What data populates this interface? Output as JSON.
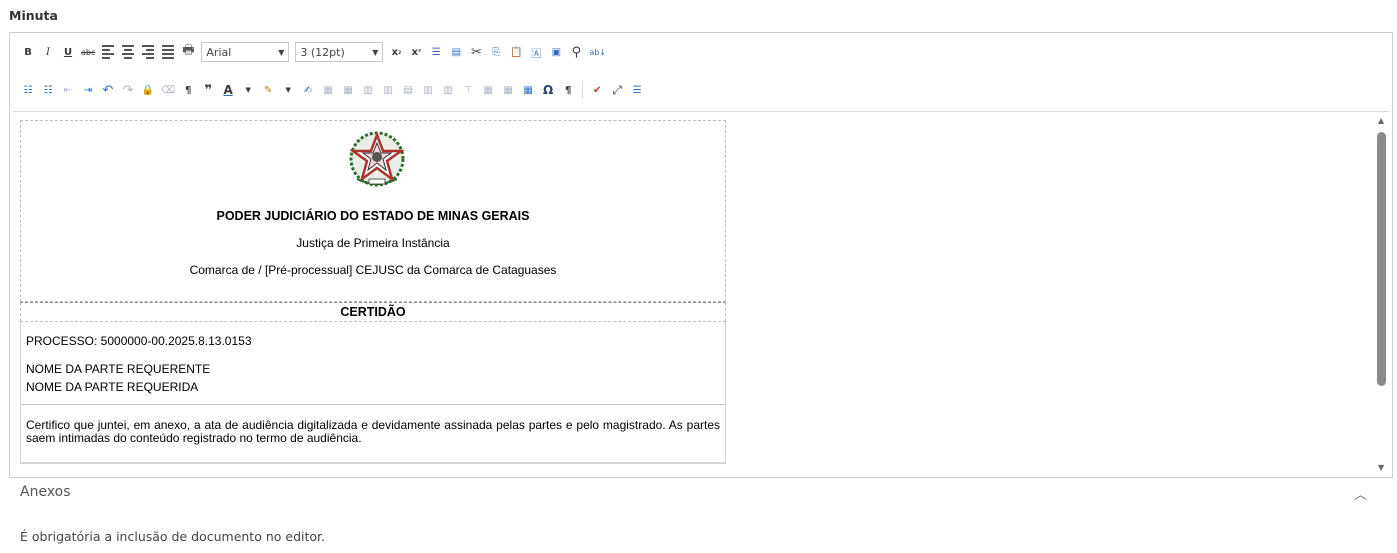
{
  "section_label": "Minuta",
  "toolbar": {
    "font_family": "Arial",
    "font_size": "3 (12pt)"
  },
  "document": {
    "court_title": "PODER JUDICIÁRIO DO ESTADO DE MINAS GERAIS",
    "instance": "Justiça de Primeira Instância",
    "district": "Comarca de  / [Pré-processual] CEJUSC da Comarca de Cataguases",
    "cert_heading": "CERTIDÃO",
    "process": "PROCESSO: 5000000-00.2025.8.13.0153",
    "party_requester": "NOME DA PARTE REQUERENTE",
    "party_requested": "NOME DA PARTE REQUERIDA",
    "body": "Certifico que juntei, em anexo, a ata de audiência digitalizada e devidamente assinada pelas partes e pelo magistrado. As partes saem intimadas do conteúdo registrado no termo de audiência."
  },
  "attachments": {
    "label": "Anexos",
    "notice": "É obrigatória a inclusão de documento no editor."
  },
  "colors": {
    "accent_blue": "#2f6ec4",
    "seal_red": "#b03030",
    "seal_green": "#2e6b2e"
  }
}
